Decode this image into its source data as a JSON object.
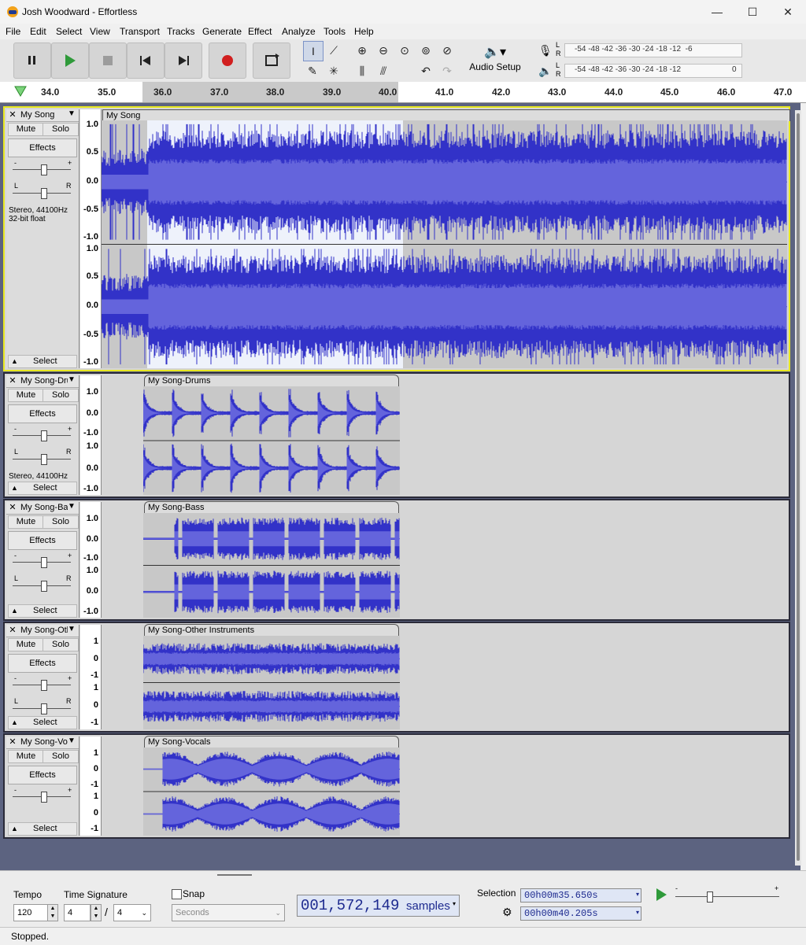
{
  "window": {
    "title": "Josh Woodward - Effortless",
    "minimize": "—",
    "maximize": "☐",
    "close": "✕"
  },
  "menu": [
    "File",
    "Edit",
    "Select",
    "View",
    "Transport",
    "Tracks",
    "Generate",
    "Effect",
    "Analyze",
    "Tools",
    "Help"
  ],
  "toolbar": {
    "audio_setup": "Audio Setup",
    "record_meter_label": "-54 -48 -42 -36 -30 -24 -18 -12  -6",
    "play_meter_label": "-54 -48 -42 -36 -30 -24 -18 -12",
    "play_meter_end": "0",
    "meter_L": "L",
    "meter_R": "R"
  },
  "ruler": {
    "ticks": [
      "34.0",
      "35.0",
      "36.0",
      "37.0",
      "38.0",
      "39.0",
      "40.0",
      "41.0",
      "42.0",
      "43.0",
      "44.0",
      "45.0",
      "46.0",
      "47.0"
    ]
  },
  "tracks": [
    {
      "name": "My Song",
      "clip": "My Song",
      "info1": "Stereo, 44100Hz",
      "info2": "32-bit float",
      "scale": [
        "1.0",
        "0.5",
        "0.0",
        "-0.5",
        "-1.0"
      ]
    },
    {
      "name": "My Song-Dru",
      "clip": "My Song-Drums",
      "info1": "Stereo, 44100Hz",
      "info2": "",
      "scale": [
        "1.0",
        "0.0",
        "-1.0"
      ]
    },
    {
      "name": "My Song-Ba",
      "clip": "My Song-Bass",
      "info1": "",
      "info2": "",
      "scale": [
        "1.0",
        "0.0",
        "-1.0"
      ]
    },
    {
      "name": "My Song-Oth",
      "clip": "My Song-Other Instruments",
      "info1": "",
      "info2": "",
      "scale": [
        "1",
        "0",
        "-1"
      ]
    },
    {
      "name": "My Song-Vo",
      "clip": "My Song-Vocals",
      "info1": "",
      "info2": "",
      "scale": [
        "1",
        "0",
        "-1"
      ]
    }
  ],
  "track_controls": {
    "mute": "Mute",
    "solo": "Solo",
    "effects": "Effects",
    "select": "Select",
    "close": "✕",
    "L": "L",
    "R": "R",
    "plus": "+",
    "minus": "-"
  },
  "bottom": {
    "tempo_label": "Tempo",
    "tempo_value": "120",
    "timesig_label": "Time Signature",
    "timesig_num": "4",
    "timesig_den": "4",
    "timesig_slash": "/",
    "snap_label": "Snap",
    "snap_unit": "Seconds",
    "position_value": "001,572,149",
    "position_unit": "samples",
    "selection_label": "Selection",
    "sel_start": "00h00m35.650s",
    "sel_end": "00h00m40.205s"
  },
  "status": "Stopped.",
  "colors": {
    "wave": "#3232c8",
    "wave_rms": "#6464dc",
    "selection_bg": "#ffffff",
    "track_bg": "#d6d6d6",
    "focus_border": "#e8e820",
    "track_area_bg": "#5c6380"
  }
}
